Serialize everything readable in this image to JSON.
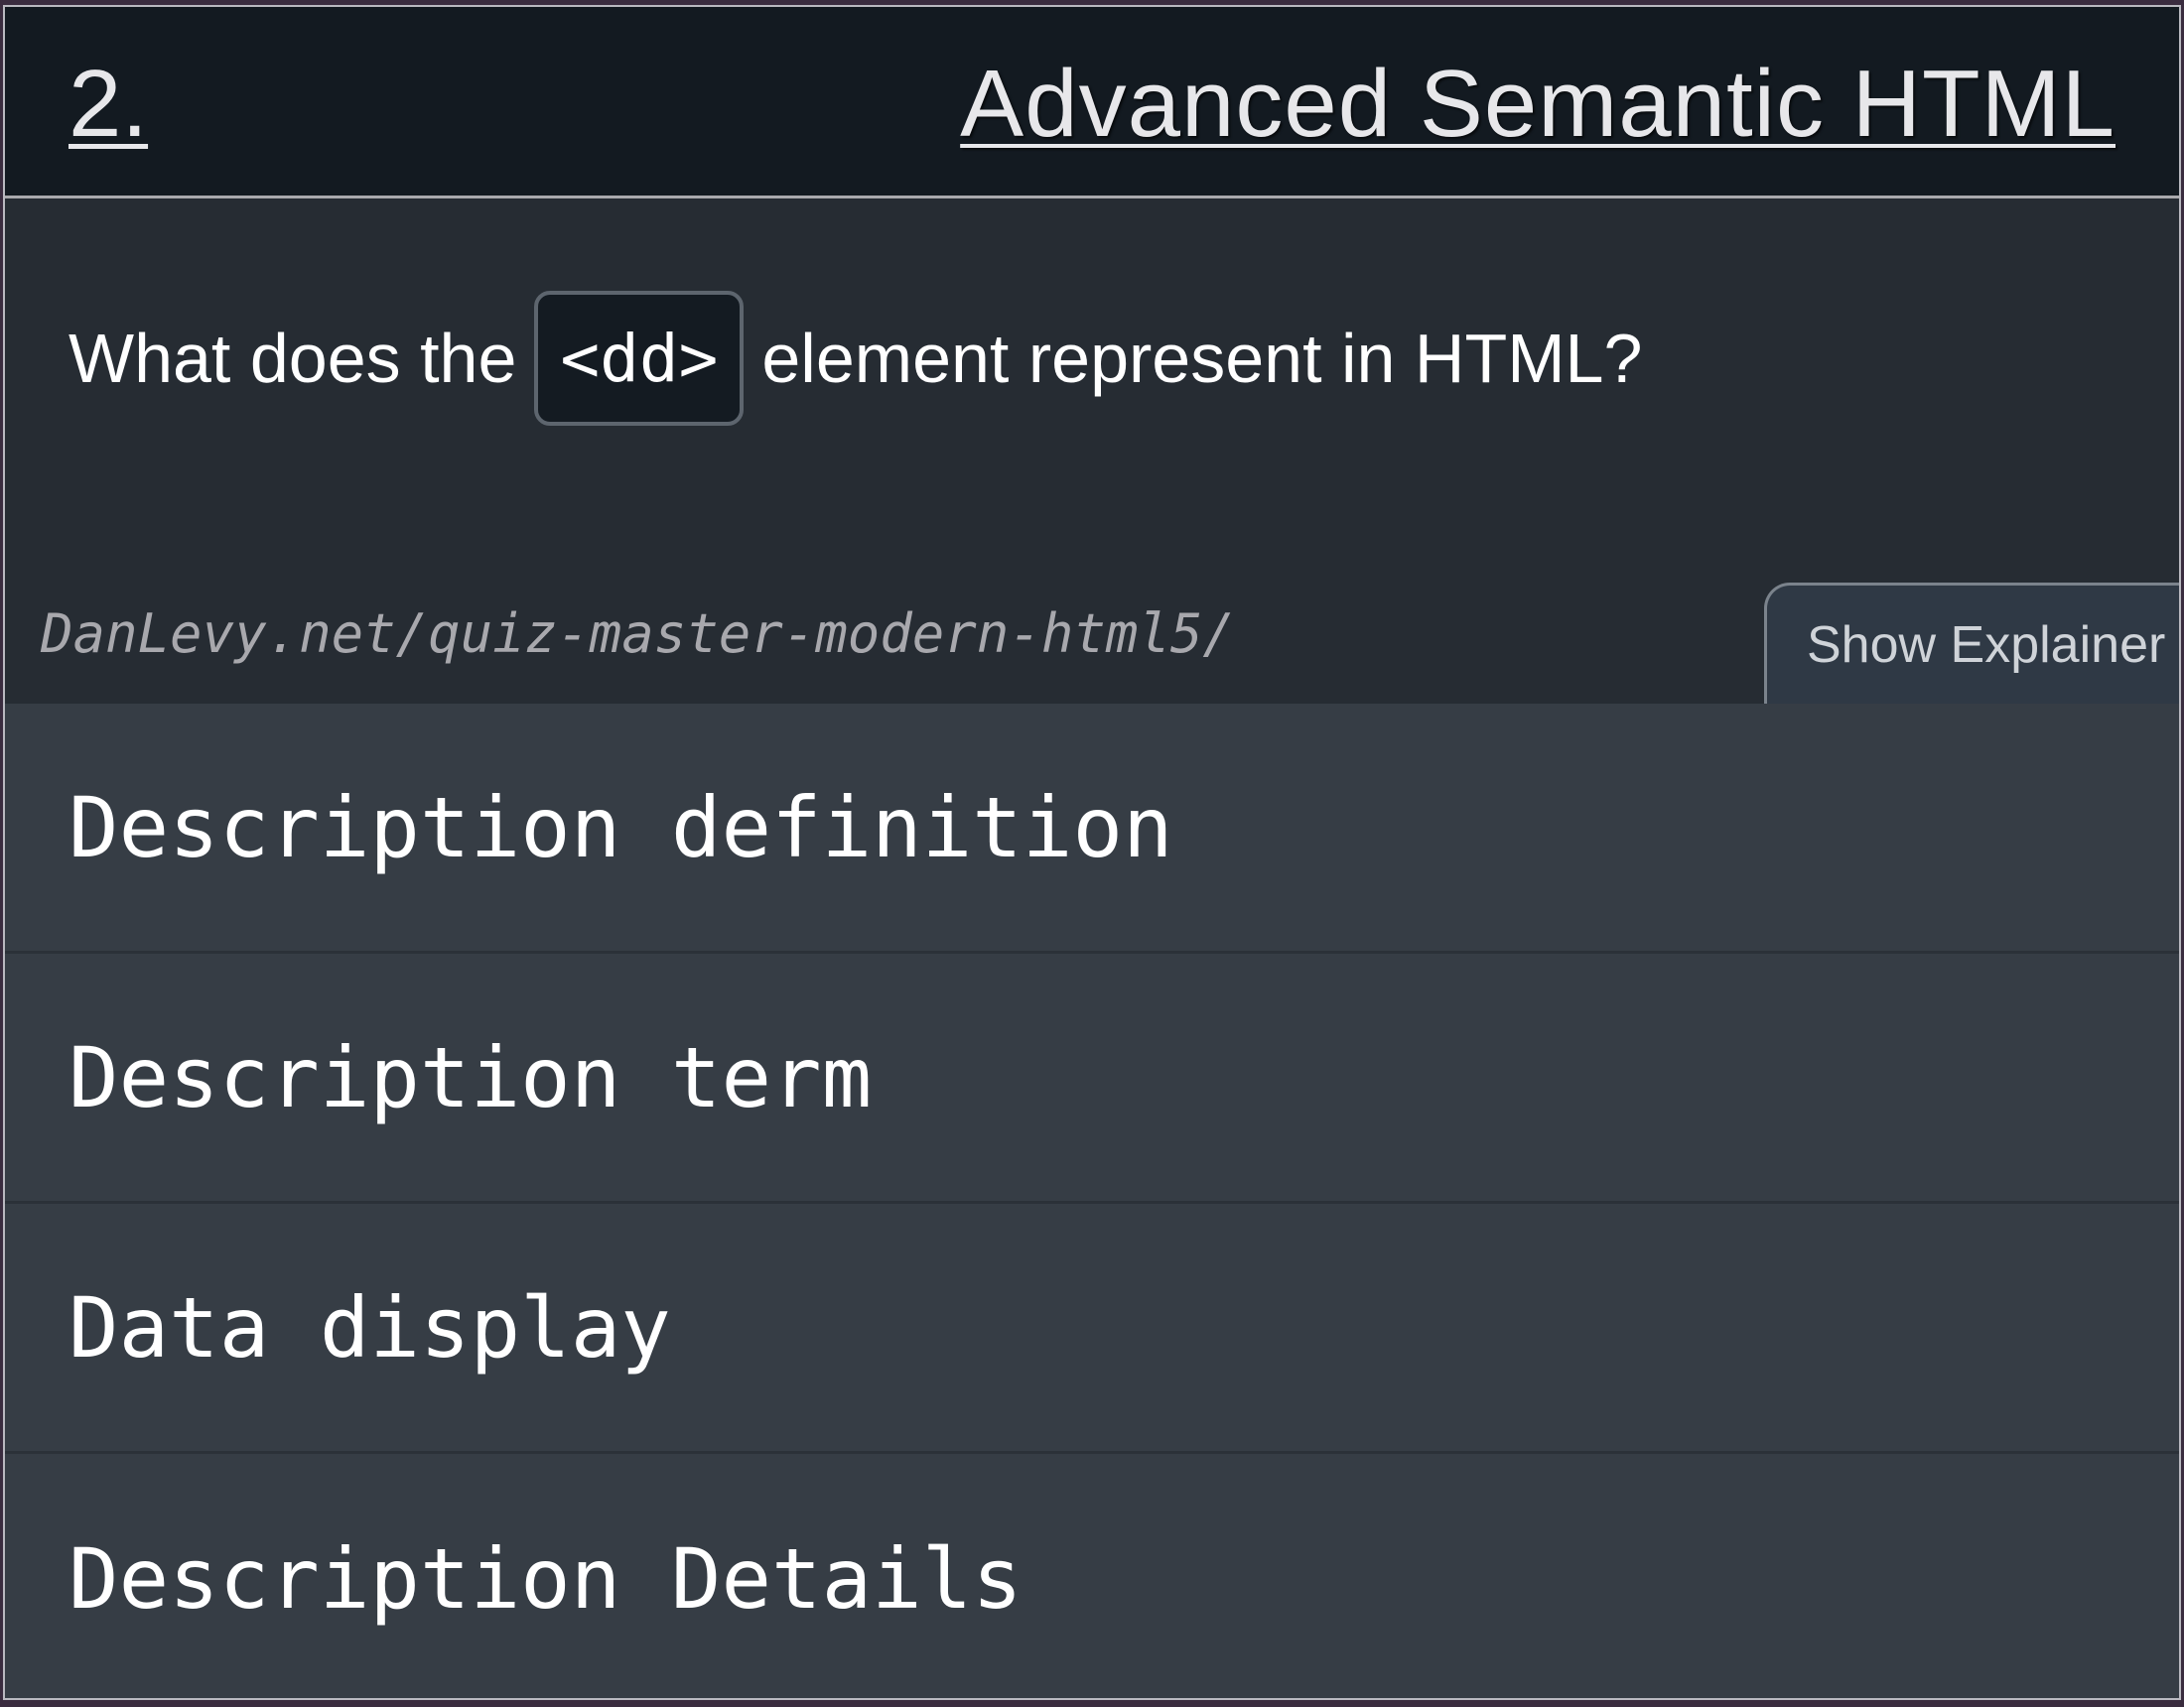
{
  "header": {
    "number": "2.",
    "title": "Advanced Semantic HTML"
  },
  "question": {
    "prefix": "What does the",
    "code": "<dd>",
    "suffix": "element represent in HTML?"
  },
  "source": {
    "url_text": "DanLevy.net/quiz-master-modern-html5/"
  },
  "explainer_button": {
    "label": "Show Explainer"
  },
  "answers": [
    {
      "label": "Description definition"
    },
    {
      "label": "Description term"
    },
    {
      "label": "Data display"
    },
    {
      "label": "Description Details"
    }
  ],
  "colors": {
    "page_background": "#3a2c3f",
    "header_background": "#131a21",
    "card_background": "#262c33",
    "answer_background": "#363d45",
    "text": "#ffffff"
  }
}
